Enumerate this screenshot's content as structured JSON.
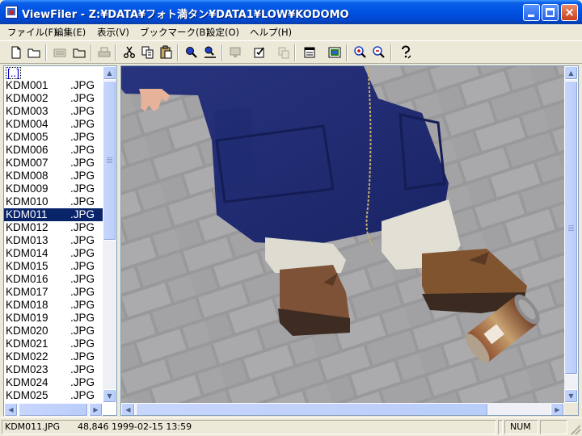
{
  "window": {
    "title": "ViewFiler - Z:¥DATA¥フォト満タン¥DATA1¥LOW¥KODOMO"
  },
  "menu": {
    "items": [
      {
        "label": "ファイル(F)"
      },
      {
        "label": "編集(E)"
      },
      {
        "label": "表示(V)"
      },
      {
        "label": "ブックマーク(B)"
      },
      {
        "label": "設定(O)"
      },
      {
        "label": "ヘルプ(H)"
      }
    ]
  },
  "toolbar": {
    "buttons": [
      "new-file-icon",
      "open-folder-icon",
      "list-view-icon",
      "folder-icon",
      "printer-icon",
      "cut-icon",
      "copy-icon",
      "paste-icon",
      "search-icon",
      "find-next-icon",
      "monitor-icon",
      "properties-icon",
      "duplicate-icon",
      "calendar-icon",
      "picture-icon",
      "zoom-in-icon",
      "zoom-out-icon",
      "help-icon"
    ]
  },
  "filelist": {
    "parent_label": "[..]",
    "selected_index": 11,
    "files": [
      {
        "name": "KDM001",
        "ext": ".JPG"
      },
      {
        "name": "KDM002",
        "ext": ".JPG"
      },
      {
        "name": "KDM003",
        "ext": ".JPG"
      },
      {
        "name": "KDM004",
        "ext": ".JPG"
      },
      {
        "name": "KDM005",
        "ext": ".JPG"
      },
      {
        "name": "KDM006",
        "ext": ".JPG"
      },
      {
        "name": "KDM007",
        "ext": ".JPG"
      },
      {
        "name": "KDM008",
        "ext": ".JPG"
      },
      {
        "name": "KDM009",
        "ext": ".JPG"
      },
      {
        "name": "KDM010",
        "ext": ".JPG"
      },
      {
        "name": "KDM011",
        "ext": ".JPG"
      },
      {
        "name": "KDM012",
        "ext": ".JPG"
      },
      {
        "name": "KDM013",
        "ext": ".JPG"
      },
      {
        "name": "KDM014",
        "ext": ".JPG"
      },
      {
        "name": "KDM015",
        "ext": ".JPG"
      },
      {
        "name": "KDM016",
        "ext": ".JPG"
      },
      {
        "name": "KDM017",
        "ext": ".JPG"
      },
      {
        "name": "KDM018",
        "ext": ".JPG"
      },
      {
        "name": "KDM019",
        "ext": ".JPG"
      },
      {
        "name": "KDM020",
        "ext": ".JPG"
      },
      {
        "name": "KDM021",
        "ext": ".JPG"
      },
      {
        "name": "KDM022",
        "ext": ".JPG"
      },
      {
        "name": "KDM023",
        "ext": ".JPG"
      },
      {
        "name": "KDM024",
        "ext": ".JPG"
      },
      {
        "name": "KDM025",
        "ext": ".JPG"
      }
    ]
  },
  "status": {
    "filename": "KDM011.JPG",
    "info": "48,846 1999-02-15 13:59",
    "num": "NUM"
  },
  "colors": {
    "titlebar": "#0054e3",
    "selection": "#0a246a",
    "chrome": "#ece9d8"
  }
}
